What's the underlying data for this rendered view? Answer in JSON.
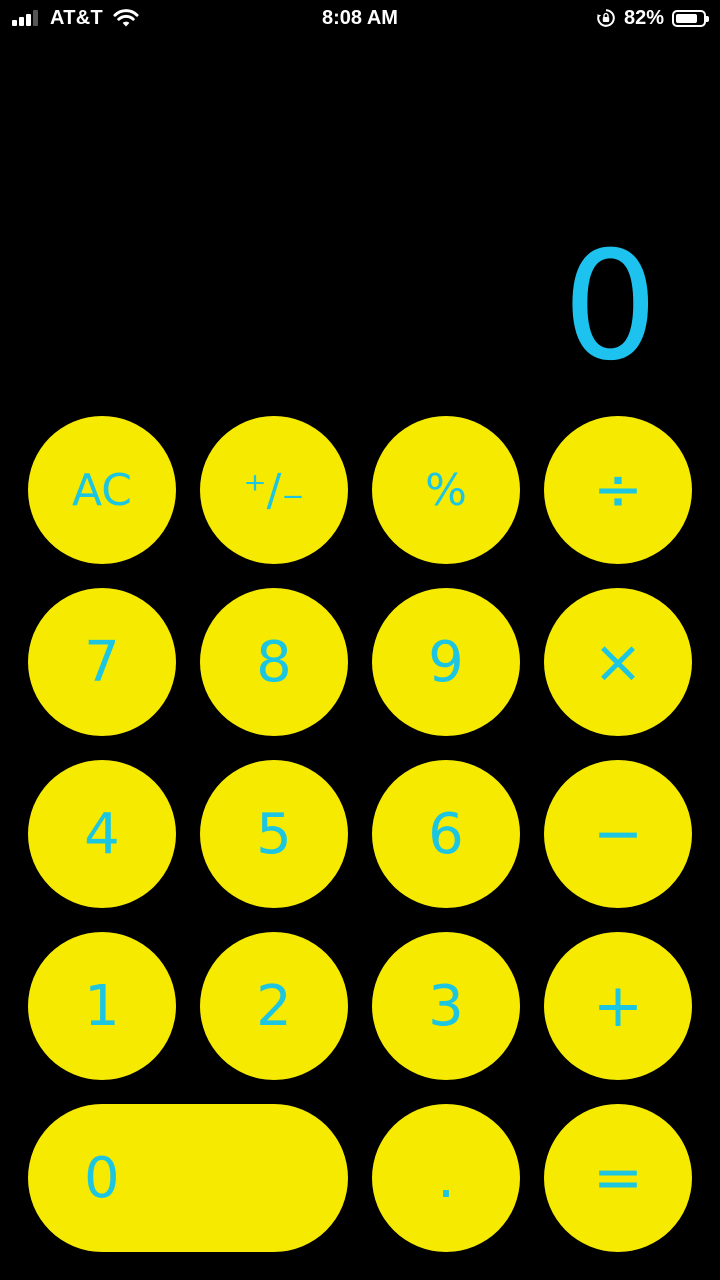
{
  "status_bar": {
    "carrier": "AT&T",
    "time": "8:08 AM",
    "battery_percent": "82%",
    "battery_level": 0.82,
    "icons": [
      "signal-icon",
      "wifi-icon",
      "orientation-lock-icon",
      "battery-icon"
    ]
  },
  "display": {
    "value": "0"
  },
  "keys": {
    "clear": "AC",
    "sign": "⁺∕₋",
    "percent": "%",
    "divide": "÷",
    "seven": "7",
    "eight": "8",
    "nine": "9",
    "multiply": "×",
    "four": "4",
    "five": "5",
    "six": "6",
    "minus": "−",
    "one": "1",
    "two": "2",
    "three": "3",
    "plus": "+",
    "zero": "0",
    "decimal": ".",
    "equals": "="
  },
  "colors": {
    "background": "#000000",
    "key_background": "#f5ea00",
    "key_text": "#1cc6e2",
    "display_text": "#1ec2ee"
  }
}
